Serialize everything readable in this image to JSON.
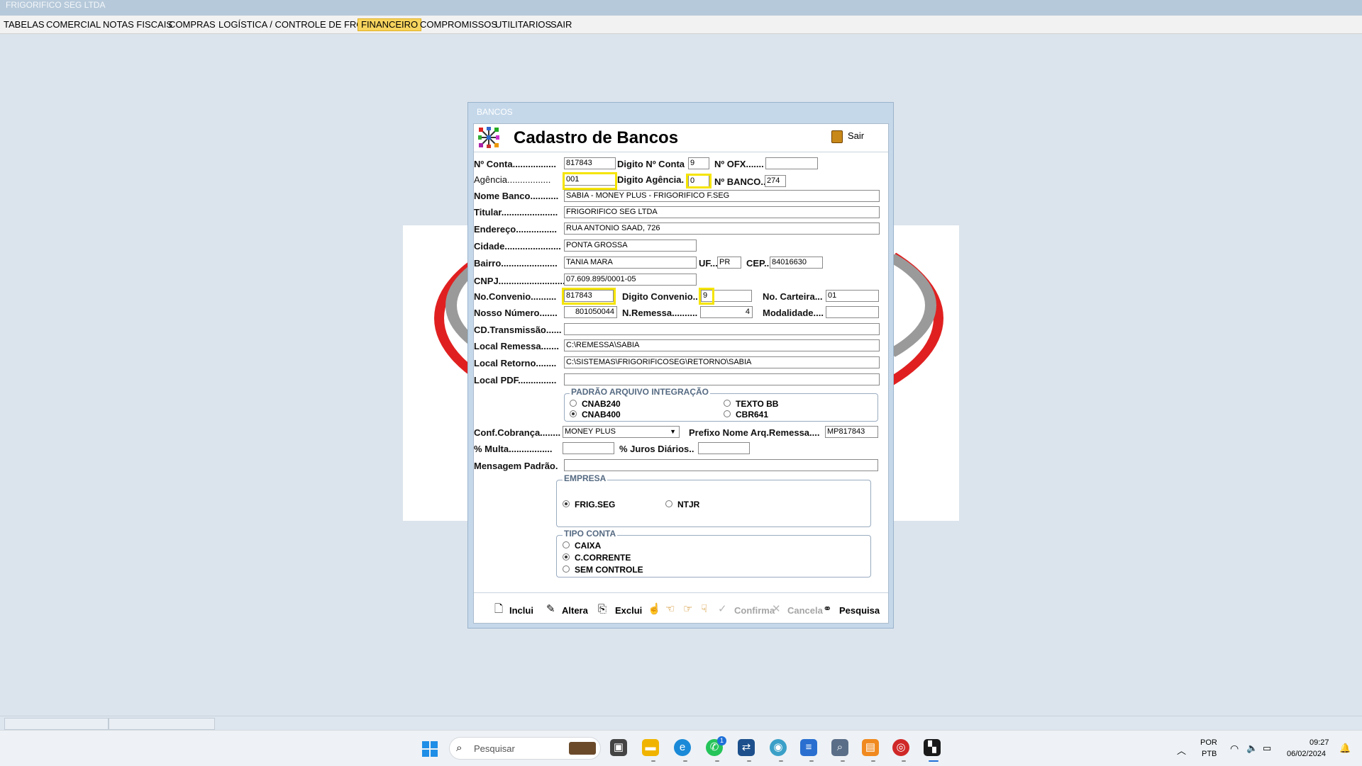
{
  "app": {
    "title": "FRIGORIFICO SEG LTDA"
  },
  "menu": [
    "TABELAS",
    "COMERCIAL",
    "NOTAS FISCAIS",
    "COMPRAS",
    "LOGÍSTICA / CONTROLE DE FROTAS",
    "FINANCEIRO",
    "COMPROMISSOS",
    "UTILITARIOS",
    "SAIR"
  ],
  "menu_active": "FINANCEIRO",
  "dialog": {
    "caption": "BANCOS",
    "title": "Cadastro de Bancos",
    "close_label": "Sair"
  },
  "form": {
    "labels": {
      "conta": "Nº Conta.................",
      "digito_conta": "Digito Nº Conta",
      "ofx": "Nº OFX.......",
      "agencia": "Agência.................",
      "digito_agencia": "Digito Agência.",
      "banco": "Nº BANCO..",
      "nome_banco": "Nome Banco...........",
      "titular": "Titular......................",
      "endereco": "Endereço................",
      "cidade": "Cidade......................",
      "bairro": "Bairro......................",
      "uf": "UF...",
      "cep": "CEP..",
      "cnpj": "CNPJ..........................",
      "convenio": "No.Convenio..........",
      "digito_convenio": "Digito Convenio..",
      "carteira": "No. Carteira...",
      "nosso_numero": "Nosso Número.......",
      "remessa": "N.Remessa..........",
      "modalidade": "Modalidade....",
      "transmissao": "CD.Transmissão......",
      "local_remessa": "Local Remessa.......",
      "local_retorno": "Local Retorno........",
      "local_pdf": "Local PDF...............",
      "conf_cobranca": "Conf.Cobrança........",
      "prefixo": "Prefixo Nome Arq.Remessa....",
      "multa": "% Multa.................",
      "juros": "% Juros Diários..",
      "mensagem": "Mensagem Padrão."
    },
    "values": {
      "conta": "817843",
      "digito_conta": "9",
      "ofx": "",
      "agencia": "001",
      "digito_agencia": "0",
      "banco": "274",
      "nome_banco": "SABIA - MONEY PLUS - FRIGORIFICO F.SEG",
      "titular": "FRIGORIFICO SEG LTDA",
      "endereco": "RUA ANTONIO SAAD, 726",
      "cidade": "PONTA GROSSA",
      "bairro": "TANIA MARA",
      "uf": "PR",
      "cep": "84016630",
      "cnpj": "07.609.895/0001-05",
      "convenio": "817843",
      "digito_convenio": "9",
      "carteira": "01",
      "nosso_numero": "801050044",
      "remessa": "4",
      "modalidade": "",
      "transmissao": "",
      "local_remessa": "C:\\REMESSA\\SABIA",
      "local_retorno": "C:\\SISTEMAS\\FRIGORIFICOSEG\\RETORNO\\SABIA",
      "local_pdf": "",
      "conf_cobranca": "MONEY PLUS",
      "prefixo": "MP817843",
      "multa": "",
      "juros": "",
      "mensagem": ""
    }
  },
  "padrao": {
    "title": "PADRÃO ARQUIVO INTEGRAÇÃO",
    "options": [
      "CNAB240",
      "CNAB400",
      "TEXTO BB",
      "CBR641"
    ],
    "selected": "CNAB400"
  },
  "empresa": {
    "title": "EMPRESA",
    "options": [
      "FRIG.SEG",
      "NTJR"
    ],
    "selected": "FRIG.SEG"
  },
  "tipo_conta": {
    "title": "TIPO CONTA",
    "options": [
      "CAIXA",
      "C.CORRENTE",
      "SEM CONTROLE"
    ],
    "selected": "C.CORRENTE"
  },
  "toolbar": {
    "inclui": "Inclui",
    "altera": "Altera",
    "exclui": "Exclui",
    "confirma": "Confirma",
    "cancela": "Cancela",
    "pesquisa": "Pesquisa"
  },
  "taskbar": {
    "search_placeholder": "Pesquisar",
    "lang_top": "POR",
    "lang_bottom": "PTB",
    "time": "09:27",
    "date": "06/02/2024",
    "whatsapp_badge": "1"
  }
}
